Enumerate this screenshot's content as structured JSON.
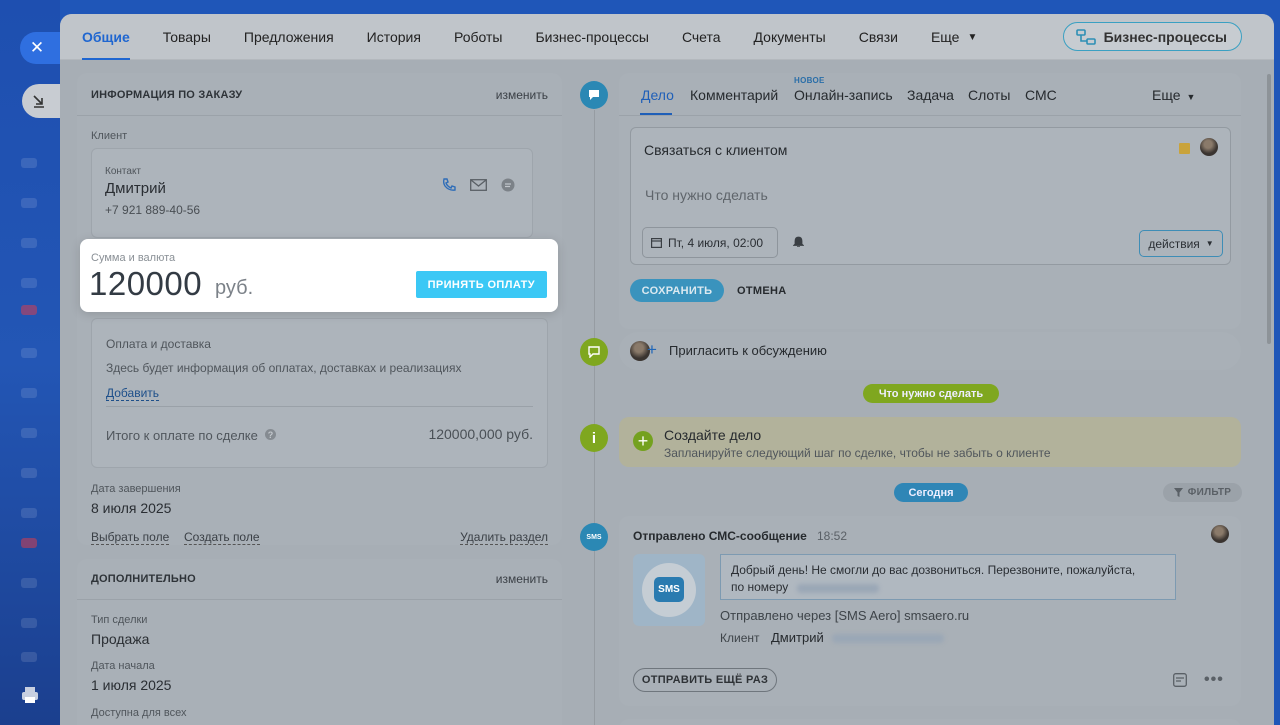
{
  "nav": {
    "tabs": [
      "Общие",
      "Товары",
      "Предложения",
      "История",
      "Роботы",
      "Бизнес-процессы",
      "Счета",
      "Документы",
      "Связи",
      "Еще"
    ],
    "bp_button": "Бизнес-процессы"
  },
  "order": {
    "header": "ИНФОРМАЦИЯ ПО ЗАКАЗУ",
    "edit": "изменить",
    "client_label": "Клиент",
    "contact_label": "Контакт",
    "contact_name": "Дмитрий",
    "contact_phone": "+7 921 889-40-56",
    "sum_label": "Сумма и валюта",
    "sum_value": "120000",
    "currency": "руб.",
    "accept_button": "ПРИНЯТЬ ОПЛАТУ",
    "payment_label": "Оплата и доставка",
    "payment_info": "Здесь будет информация об оплатах, доставках и реализациях",
    "add_link": "Добавить",
    "total_label": "Итого к оплате по сделке",
    "total_value": "120000,000 руб.",
    "close_date_label": "Дата завершения",
    "close_date": "8 июля 2025",
    "choose_field": "Выбрать поле",
    "create_field": "Создать поле",
    "delete_section": "Удалить раздел"
  },
  "extra": {
    "header": "ДОПОЛНИТЕЛЬНО",
    "edit": "изменить",
    "deal_type_label": "Тип сделки",
    "deal_type": "Продажа",
    "start_label": "Дата начала",
    "start_date": "1 июля 2025",
    "available_label": "Доступна для всех"
  },
  "activity": {
    "tabs": [
      "Дело",
      "Комментарий",
      "Онлайн-запись",
      "Задача",
      "Слоты",
      "СМС"
    ],
    "new_badge": "НОВОЕ",
    "more": "Еще",
    "title": "Связаться с клиентом",
    "placeholder": "Что нужно сделать",
    "date": "Пт, 4 июля, 02:00",
    "actions": "действия",
    "save": "СОХРАНИТЬ",
    "cancel": "ОТМЕНА"
  },
  "invite": "Пригласить к обсуждению",
  "todo_pill": "Что нужно сделать",
  "create_task": {
    "title": "Создайте дело",
    "subtitle": "Запланируйте следующий шаг по сделке, чтобы не забыть о клиенте"
  },
  "today_pill": "Сегодня",
  "filter": "ФИЛЬТР",
  "sms": {
    "title": "Отправлено СМС-сообщение",
    "time": "18:52",
    "icon_text": "SMS",
    "message_line1": "Добрый день! Не смогли до вас дозвониться. Перезвоните, пожалуйста,",
    "message_line2": "по номеру",
    "sent_via": "Отправлено через [SMS Aero] smsaero.ru",
    "client_label": "Клиент",
    "client_name": "Дмитрий",
    "resend": "ОТПРАВИТЬ ЕЩЁ РАЗ"
  }
}
